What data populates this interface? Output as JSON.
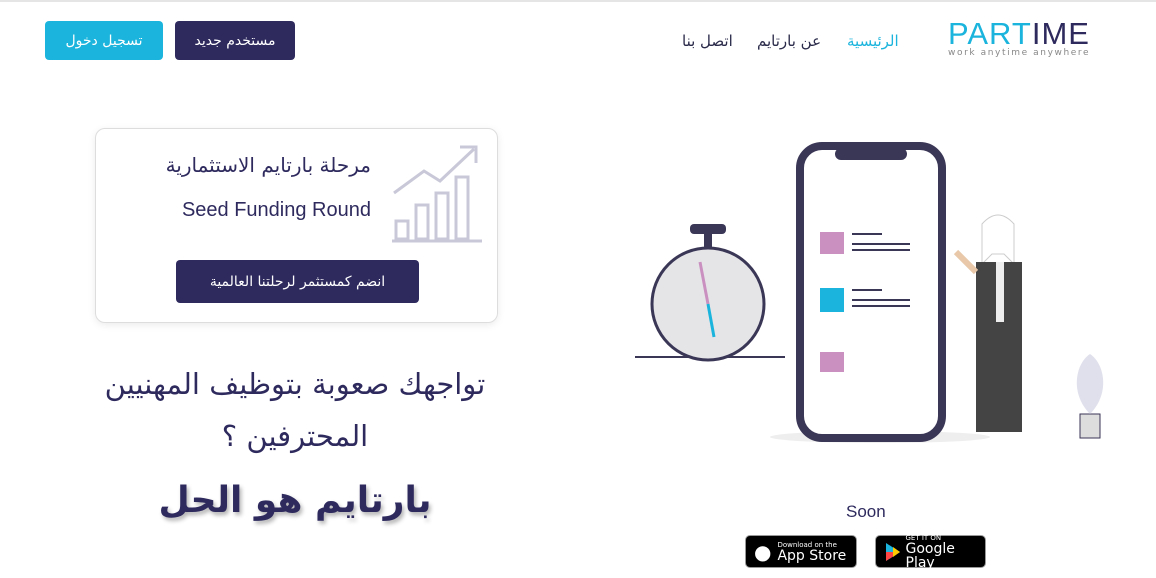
{
  "header": {
    "logo_main": "PART",
    "logo_accent": "IME",
    "logo_tagline": "work anytime anywhere",
    "nav": [
      "الرئيسية",
      "عن بارتايم",
      "اتصل بنا"
    ],
    "new_user": "مستخدم جديد",
    "login": "تسجيل دخول"
  },
  "card": {
    "title": "مرحلة بارتايم الاستثمارية",
    "subtitle": "Seed Funding Round",
    "cta": "انضم كمستثمر لرحلتنا العالمية"
  },
  "hero": {
    "question": "تواجهك صعوبة بتوظيف المهنيين المحترفين ؟",
    "answer": "بارتايم هو الحل"
  },
  "apps": {
    "soon": "Soon",
    "appstore_small": "Download on the",
    "appstore_big": "App Store",
    "play_small": "GET IT ON",
    "play_big": "Google Play"
  },
  "colors": {
    "primary": "#2e2a5e",
    "accent": "#1ab4dc"
  }
}
